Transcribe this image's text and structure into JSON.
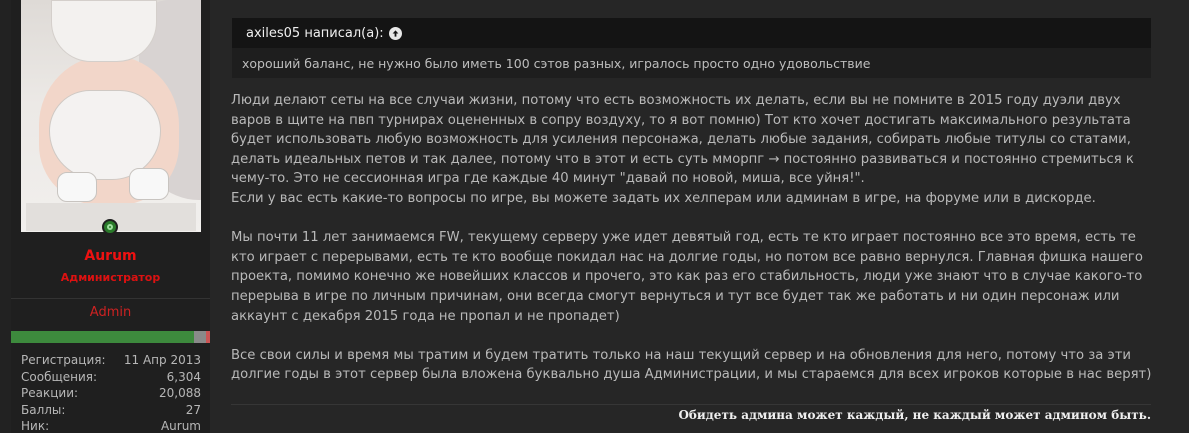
{
  "user": {
    "avatar_icon": "user-avatar-image",
    "username": "Aurum",
    "usertitle": "Администратор",
    "role_banner": "Admin",
    "reputation_fraction": 0.92,
    "stats": [
      {
        "label": "Регистрация:",
        "value": "11 Апр 2013"
      },
      {
        "label": "Сообщения:",
        "value": "6,304"
      },
      {
        "label": "Реакции:",
        "value": "20,088"
      },
      {
        "label": "Баллы:",
        "value": "27"
      },
      {
        "label": "Ник:",
        "value": "Aurum"
      }
    ]
  },
  "quote": {
    "author_text": "axiles05 написал(а):",
    "jump_icon": "arrow-up-circle-icon",
    "body": "хороший баланс, не нужно было иметь 100 сэтов разных, игралось просто одно удовольствие"
  },
  "message": {
    "p1": "Люди делают сеты на все случаи жизни, потому что есть возможность их делать, если вы не помните в 2015 году дуэли двух варов в щите на пвп турнирах оцененных в сопру воздуху, то я вот помню) Тот кто хочет достигать максимального результата будет использовать любую возможность для усиления персонажа, делать любые задания, собирать любые титулы со статами, делать идеальных петов и так далее, потому что в этот и есть суть ммоpпг → постоянно развиваться и постоянно стремиться к чему-то. Это не сессионная игра где каждые 40 минут \"давай по новой, миша, все уйня!\".",
    "p2": "Если у вас есть какие-то вопросы по игре, вы можете задать их хелперам или админам в игре, на форуме или в дискорде.",
    "p3": "Мы почти 11 лет занимаемся FW, текущему серверу уже идет девятый год, есть те кто играет постоянно все это время, есть те кто играет с перерывами, есть те кто вообще покидал нас на долгие годы, но потом все равно вернулся. Главная фишка нашего проекта, помимо конечно же новейших классов и прочего, это как раз его стабильность, люди уже знают что в случае какого-то перерыва в игре по личным причинам, они всегда смогут вернуться и тут все будет так же работать и ни один персонаж или аккаунт с декабря 2015 года не пропал и не пропадет)",
    "p4": "Все свои силы и время мы тратим и будем тратить только на наш текущий сервер и на обновления для него, потому что за эти долгие годы в этот сервер была вложена буквально душа Администрации, и мы стараемся для всех игроков которые в нас верят)"
  },
  "signature": "Обидеть админа может каждый, не каждый может админом быть."
}
